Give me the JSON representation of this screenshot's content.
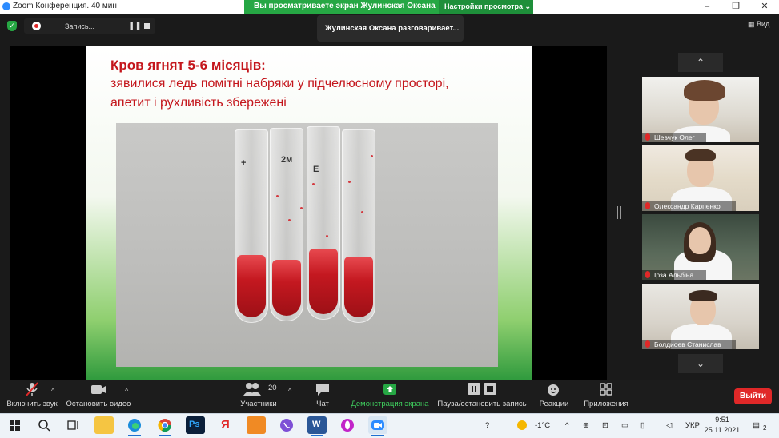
{
  "window": {
    "title": "Zoom Конференция. 40 мин",
    "controls": [
      "–",
      "❐",
      "✕"
    ]
  },
  "share_banner": {
    "message": "Вы просматриваете экран Жулинская Оксана",
    "view_options": "Настройки просмотра ⌄"
  },
  "recording": {
    "label": "Запись...",
    "pause": "❚❚"
  },
  "speaker_notice": "Жулинская Оксана разговаривает...",
  "view_button": "Вид",
  "slide": {
    "heading": "Кров ягнят 5-6 місяців:",
    "line1": "зявилися ледь помітні набряки у підчелюсному просторі,",
    "line2": "апетит і рухливість збережені",
    "tube_marks": [
      "+",
      "2м",
      "Е"
    ]
  },
  "participants_panel": {
    "scroll_up": "⌃",
    "scroll_down": "⌄",
    "tiles": [
      {
        "name": "Шевчук Олег",
        "muted": true
      },
      {
        "name": "Олександр Карпенко",
        "muted": true
      },
      {
        "name": "Ірза Альбіна",
        "muted": true
      },
      {
        "name": "Болдиоев Станислав",
        "muted": true
      }
    ]
  },
  "toolbar": {
    "mute": "Включить звук",
    "video": "Остановить видео",
    "participants_count": "20",
    "participants": "Участники",
    "chat": "Чат",
    "share": "Демонстрация экрана",
    "record": "Пауза/остановить запись",
    "reactions": "Реакции",
    "apps": "Приложения",
    "leave": "Выйти"
  },
  "taskbar": {
    "weather": "-1°C",
    "language": "УКР",
    "time": "9:51",
    "date": "25.11.2021",
    "notifications": "2"
  },
  "colors": {
    "share_green": "#26a744",
    "slide_red": "#c4161c",
    "leave_red": "#e02828",
    "toolbar_bg": "#1c1c1c"
  }
}
